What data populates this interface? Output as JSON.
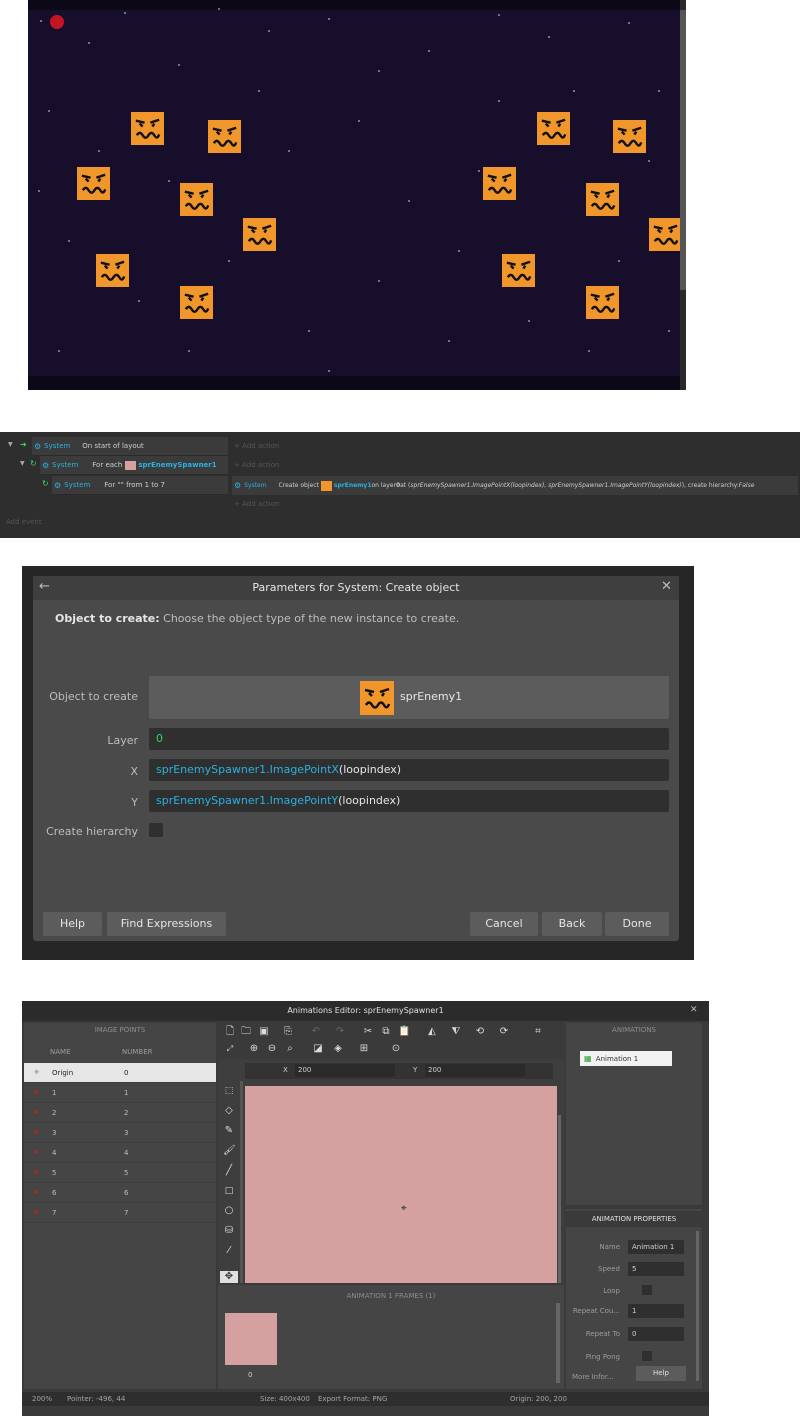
{
  "game": {
    "stars": [
      [
        12,
        20
      ],
      [
        60,
        42
      ],
      [
        96,
        12
      ],
      [
        150,
        64
      ],
      [
        190,
        8
      ],
      [
        240,
        30
      ],
      [
        300,
        18
      ],
      [
        350,
        70
      ],
      [
        400,
        50
      ],
      [
        470,
        14
      ],
      [
        520,
        36
      ],
      [
        600,
        22
      ],
      [
        630,
        90
      ],
      [
        20,
        110
      ],
      [
        70,
        150
      ],
      [
        140,
        180
      ],
      [
        260,
        150
      ],
      [
        330,
        120
      ],
      [
        380,
        200
      ],
      [
        450,
        170
      ],
      [
        560,
        190
      ],
      [
        620,
        160
      ],
      [
        40,
        240
      ],
      [
        110,
        300
      ],
      [
        200,
        260
      ],
      [
        280,
        330
      ],
      [
        350,
        280
      ],
      [
        430,
        250
      ],
      [
        500,
        320
      ],
      [
        590,
        260
      ],
      [
        30,
        350
      ],
      [
        160,
        350
      ],
      [
        300,
        370
      ],
      [
        420,
        340
      ],
      [
        560,
        350
      ],
      [
        640,
        330
      ],
      [
        230,
        90
      ],
      [
        470,
        100
      ],
      [
        10,
        190
      ],
      [
        545,
        90
      ]
    ],
    "enemies": [
      [
        103,
        112
      ],
      [
        180,
        120
      ],
      [
        49,
        167
      ],
      [
        152,
        183
      ],
      [
        215,
        218
      ],
      [
        68,
        254
      ],
      [
        152,
        286
      ],
      [
        509,
        112
      ],
      [
        585,
        120
      ],
      [
        455,
        167
      ],
      [
        558,
        183
      ],
      [
        621,
        218
      ],
      [
        474,
        254
      ],
      [
        558,
        286
      ]
    ]
  },
  "events": {
    "gutter": [
      "1",
      "2",
      "3"
    ],
    "rows": [
      {
        "system": "System",
        "condition": "On start of layout",
        "action": "+ Add action"
      },
      {
        "system": "System",
        "condition_prefix": "For each",
        "condition_object": "sprEnemySpawner1",
        "action": "+ Add action"
      },
      {
        "system": "System",
        "condition": "For \"\" from 1 to 7",
        "action_system": "System",
        "action_prefix": "Create object",
        "action_object": "sprEnemy1",
        "action_text": " on layer ",
        "action_layer": "0",
        "action_at": " at (",
        "action_expr": "sprEnemySpawner1.ImagePointX(loopindex), sprEnemySpawner1.ImagePointY(loopindex)",
        "action_tail": "), create hierarchy: ",
        "action_false": "False",
        "add_action": "+ Add action"
      }
    ],
    "add_event": "Add event"
  },
  "dialog": {
    "back_arrow": "←",
    "title": "Parameters for System: Create object",
    "close": "✕",
    "desc_bold": "Object to create:",
    "desc": " Choose the object type of the new instance to create.",
    "object_label": "Object to create",
    "object_value": "sprEnemy1",
    "layer_label": "Layer",
    "layer_value": "0",
    "x_label": "X",
    "x_obj": "sprEnemySpawner1",
    "x_fn": ".ImagePointX",
    "x_arg": "(loopindex)",
    "y_label": "Y",
    "y_obj": "sprEnemySpawner1",
    "y_fn": ".ImagePointY",
    "y_arg": "(loopindex)",
    "hierarchy_label": "Create hierarchy",
    "help": "Help",
    "find": "Find Expressions",
    "cancel": "Cancel",
    "back": "Back",
    "done": "Done"
  },
  "anim": {
    "title": "Animations Editor: sprEnemySpawner1",
    "close": "✕",
    "image_points_header": "IMAGE POINTS",
    "col_name": "NAME",
    "col_number": "NUMBER",
    "points": [
      {
        "name": "Origin",
        "number": "0"
      },
      {
        "name": "1",
        "number": "1"
      },
      {
        "name": "2",
        "number": "2"
      },
      {
        "name": "3",
        "number": "3"
      },
      {
        "name": "4",
        "number": "4"
      },
      {
        "name": "5",
        "number": "5"
      },
      {
        "name": "6",
        "number": "6"
      },
      {
        "name": "7",
        "number": "7"
      }
    ],
    "x_label": "X",
    "x_value": "200",
    "y_label": "Y",
    "y_value": "200",
    "frames_header": "ANIMATION 1 FRAMES (1)",
    "frame_index": "0",
    "animations_header": "ANIMATIONS",
    "animation_item": "Animation 1",
    "props_header": "ANIMATION PROPERTIES",
    "props": {
      "name_label": "Name",
      "name_value": "Animation 1",
      "speed_label": "Speed",
      "speed_value": "5",
      "loop_label": "Loop",
      "repeat_count_label": "Repeat Cou...",
      "repeat_count_value": "1",
      "repeat_to_label": "Repeat To",
      "repeat_to_value": "0",
      "ping_pong_label": "Ping Pong",
      "more_label": "More Infor...",
      "help": "Help"
    },
    "status": {
      "zoom": "200%",
      "pointer": "Pointer: -496, 44",
      "size": "Size: 400x400",
      "format": "Export Format: PNG",
      "origin": "Origin: 200, 200"
    },
    "colors": {
      "sprite": "#d4a0a0",
      "enemy": "#f0962a"
    }
  }
}
